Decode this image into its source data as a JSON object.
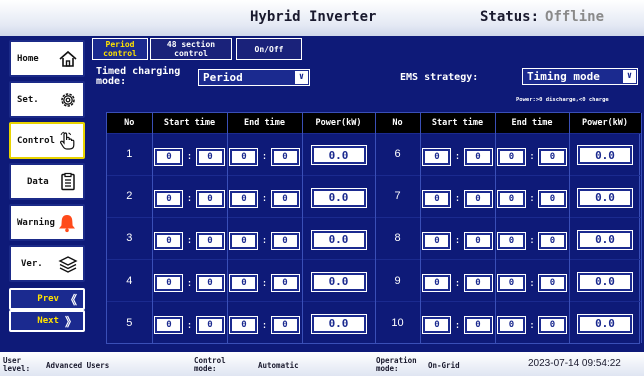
{
  "header": {
    "title": "Hybrid Inverter",
    "status_label": "Status:",
    "status_value": "Offline"
  },
  "sidebar": {
    "items": [
      {
        "label": "Home",
        "icon": "home-icon"
      },
      {
        "label": "Set.",
        "icon": "gear-icon"
      },
      {
        "label": "Control",
        "icon": "hand-pointer-icon"
      },
      {
        "label": "Data",
        "icon": "document-icon"
      },
      {
        "label": "Warning",
        "icon": "bell-icon"
      },
      {
        "label": "Ver.",
        "icon": "layers-icon"
      }
    ],
    "prev_label": "Prev",
    "next_label": "Next"
  },
  "tabs": [
    {
      "line1": "Period",
      "line2": "control"
    },
    {
      "line1": "48 section",
      "line2": "control"
    },
    {
      "line1": "On/Off",
      "line2": ""
    }
  ],
  "controls": {
    "timed_label_1": "Timed charging",
    "timed_label_2": "mode:",
    "timed_value": "Period",
    "ems_label": "EMS strategy:",
    "ems_value": "Timing mode",
    "hint": "Power:>0 discharge,<0 charge"
  },
  "table": {
    "headers": [
      "No",
      "Start time",
      "End time",
      "Power(kW)",
      "No",
      "Start time",
      "End time",
      "Power(kW)"
    ],
    "rows": [
      {
        "no_l": "1",
        "sh_l": "0",
        "sm_l": "0",
        "eh_l": "0",
        "em_l": "0",
        "p_l": "0.0",
        "no_r": "6",
        "sh_r": "0",
        "sm_r": "0",
        "eh_r": "0",
        "em_r": "0",
        "p_r": "0.0"
      },
      {
        "no_l": "2",
        "sh_l": "0",
        "sm_l": "0",
        "eh_l": "0",
        "em_l": "0",
        "p_l": "0.0",
        "no_r": "7",
        "sh_r": "0",
        "sm_r": "0",
        "eh_r": "0",
        "em_r": "0",
        "p_r": "0.0"
      },
      {
        "no_l": "3",
        "sh_l": "0",
        "sm_l": "0",
        "eh_l": "0",
        "em_l": "0",
        "p_l": "0.0",
        "no_r": "8",
        "sh_r": "0",
        "sm_r": "0",
        "eh_r": "0",
        "em_r": "0",
        "p_r": "0.0"
      },
      {
        "no_l": "4",
        "sh_l": "0",
        "sm_l": "0",
        "eh_l": "0",
        "em_l": "0",
        "p_l": "0.0",
        "no_r": "9",
        "sh_r": "0",
        "sm_r": "0",
        "eh_r": "0",
        "em_r": "0",
        "p_r": "0.0"
      },
      {
        "no_l": "5",
        "sh_l": "0",
        "sm_l": "0",
        "eh_l": "0",
        "em_l": "0",
        "p_l": "0.0",
        "no_r": "10",
        "sh_r": "0",
        "sm_r": "0",
        "eh_r": "0",
        "em_r": "0",
        "p_r": "0.0"
      }
    ]
  },
  "footer": {
    "user_label_1": "User",
    "user_label_2": "level:",
    "user_value": "Advanced Users",
    "control_label_1": "Control",
    "control_label_2": "mode:",
    "control_value": "Automatic",
    "op_label_1": "Operation",
    "op_label_2": "mode:",
    "op_value": "On-Grid",
    "datetime": "2023-07-14 09:54:22"
  },
  "colors": {
    "background": "#0e1a78",
    "accent": "#ffe200",
    "active_border": "#e8d300",
    "alarm": "#ff4a1a"
  }
}
